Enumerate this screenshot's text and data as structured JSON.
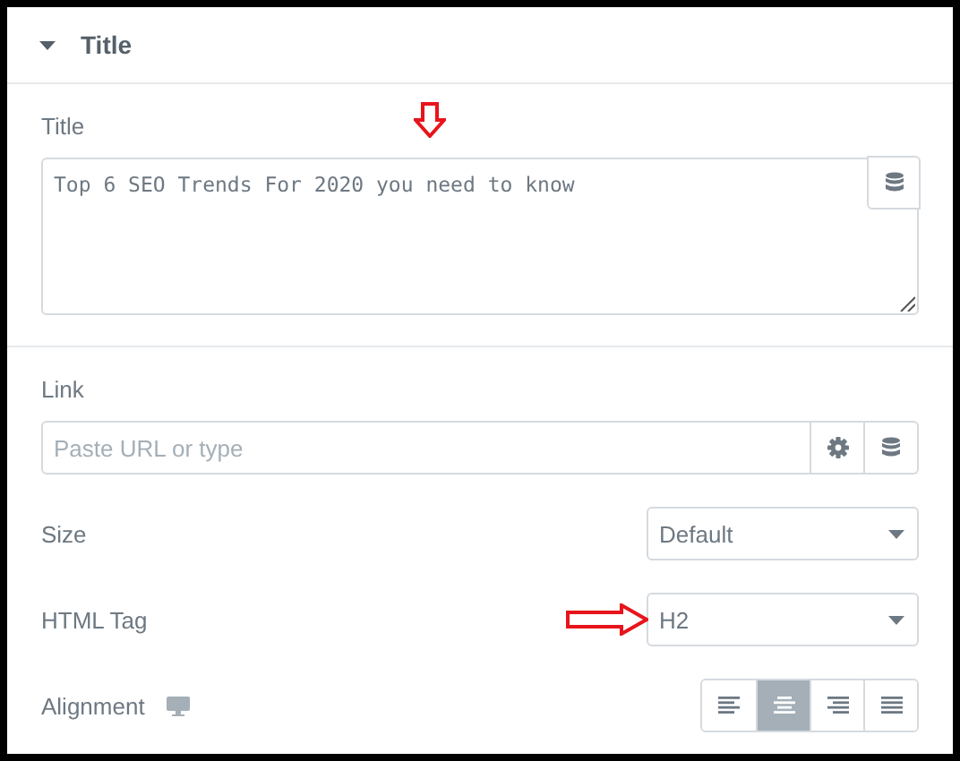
{
  "section": {
    "title": "Title",
    "expanded": true
  },
  "title_field": {
    "label": "Title",
    "value": "Top 6 SEO Trends For 2020 you need to know",
    "annotated": true
  },
  "link_field": {
    "label": "Link",
    "placeholder": "Paste URL or type"
  },
  "selects": [
    {
      "label": "Size",
      "value": "Default",
      "annotated": false
    },
    {
      "label": "HTML Tag",
      "value": "H2",
      "annotated": true
    }
  ],
  "alignment": {
    "label": "Alignment",
    "options": [
      {
        "kind": "left",
        "selected": false
      },
      {
        "kind": "center",
        "selected": true
      },
      {
        "kind": "right",
        "selected": false
      },
      {
        "kind": "justify",
        "selected": false
      }
    ]
  }
}
